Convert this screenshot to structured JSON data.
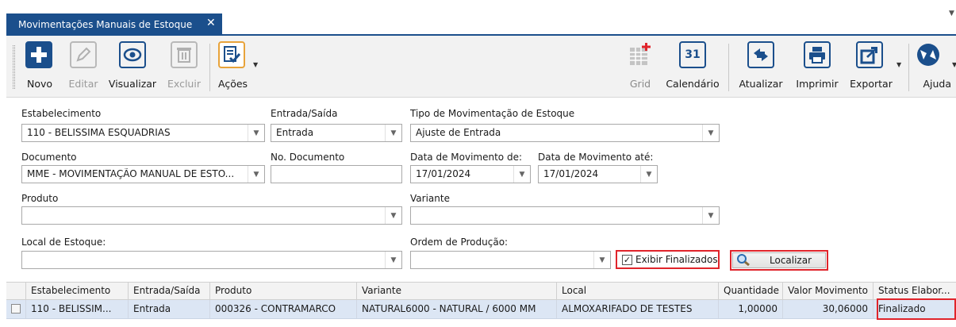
{
  "tab": {
    "title": "Movimentações Manuais de Estoque",
    "close": "✕"
  },
  "toolbar": {
    "novo": "Novo",
    "editar": "Editar",
    "visualizar": "Visualizar",
    "excluir": "Excluir",
    "acoes": "Ações",
    "grid": "Grid",
    "calendario": "Calendário",
    "calendario_day": "31",
    "atualizar": "Atualizar",
    "imprimir": "Imprimir",
    "exportar": "Exportar",
    "ajuda": "Ajuda"
  },
  "filters": {
    "estabelecimento": {
      "label": "Estabelecimento",
      "value": "110 - BELISSIMA ESQUADRIAS"
    },
    "entrada_saida": {
      "label": "Entrada/Saída",
      "value": "Entrada"
    },
    "tipo_mov": {
      "label": "Tipo de Movimentação de Estoque",
      "value": "Ajuste de Entrada"
    },
    "documento": {
      "label": "Documento",
      "value": "MME - MOVIMENTAÇÃO MANUAL DE ESTO..."
    },
    "no_documento": {
      "label": "No. Documento",
      "value": ""
    },
    "data_de": {
      "label": "Data de Movimento de:",
      "value": "17/01/2024"
    },
    "data_ate": {
      "label": "Data de Movimento até:",
      "value": "17/01/2024"
    },
    "produto": {
      "label": "Produto",
      "value": ""
    },
    "variante": {
      "label": "Variante",
      "value": ""
    },
    "local": {
      "label": "Local de Estoque:",
      "value": ""
    },
    "ordem": {
      "label": "Ordem de Produção:",
      "value": ""
    },
    "exibir_finalizados": {
      "label": "Exibir Finalizados",
      "checked": true
    },
    "localizar": "Localizar"
  },
  "grid": {
    "columns": [
      "Estabelecimento",
      "Entrada/Saída",
      "Produto",
      "Variante",
      "Local",
      "Quantidade",
      "Valor Movimento",
      "Status Elabor..."
    ],
    "rows": [
      [
        "110 - BELISSIM...",
        "Entrada",
        "000326 - CONTRAMARCO",
        "NATURAL6000 - NATURAL / 6000 MM",
        "ALMOXARIFADO DE TESTES",
        "1,00000",
        "30,06000",
        "Finalizado"
      ]
    ]
  },
  "colors": {
    "accent": "#1b4f8c",
    "highlight": "#e0242b",
    "selected_row": "#dce6f4"
  }
}
